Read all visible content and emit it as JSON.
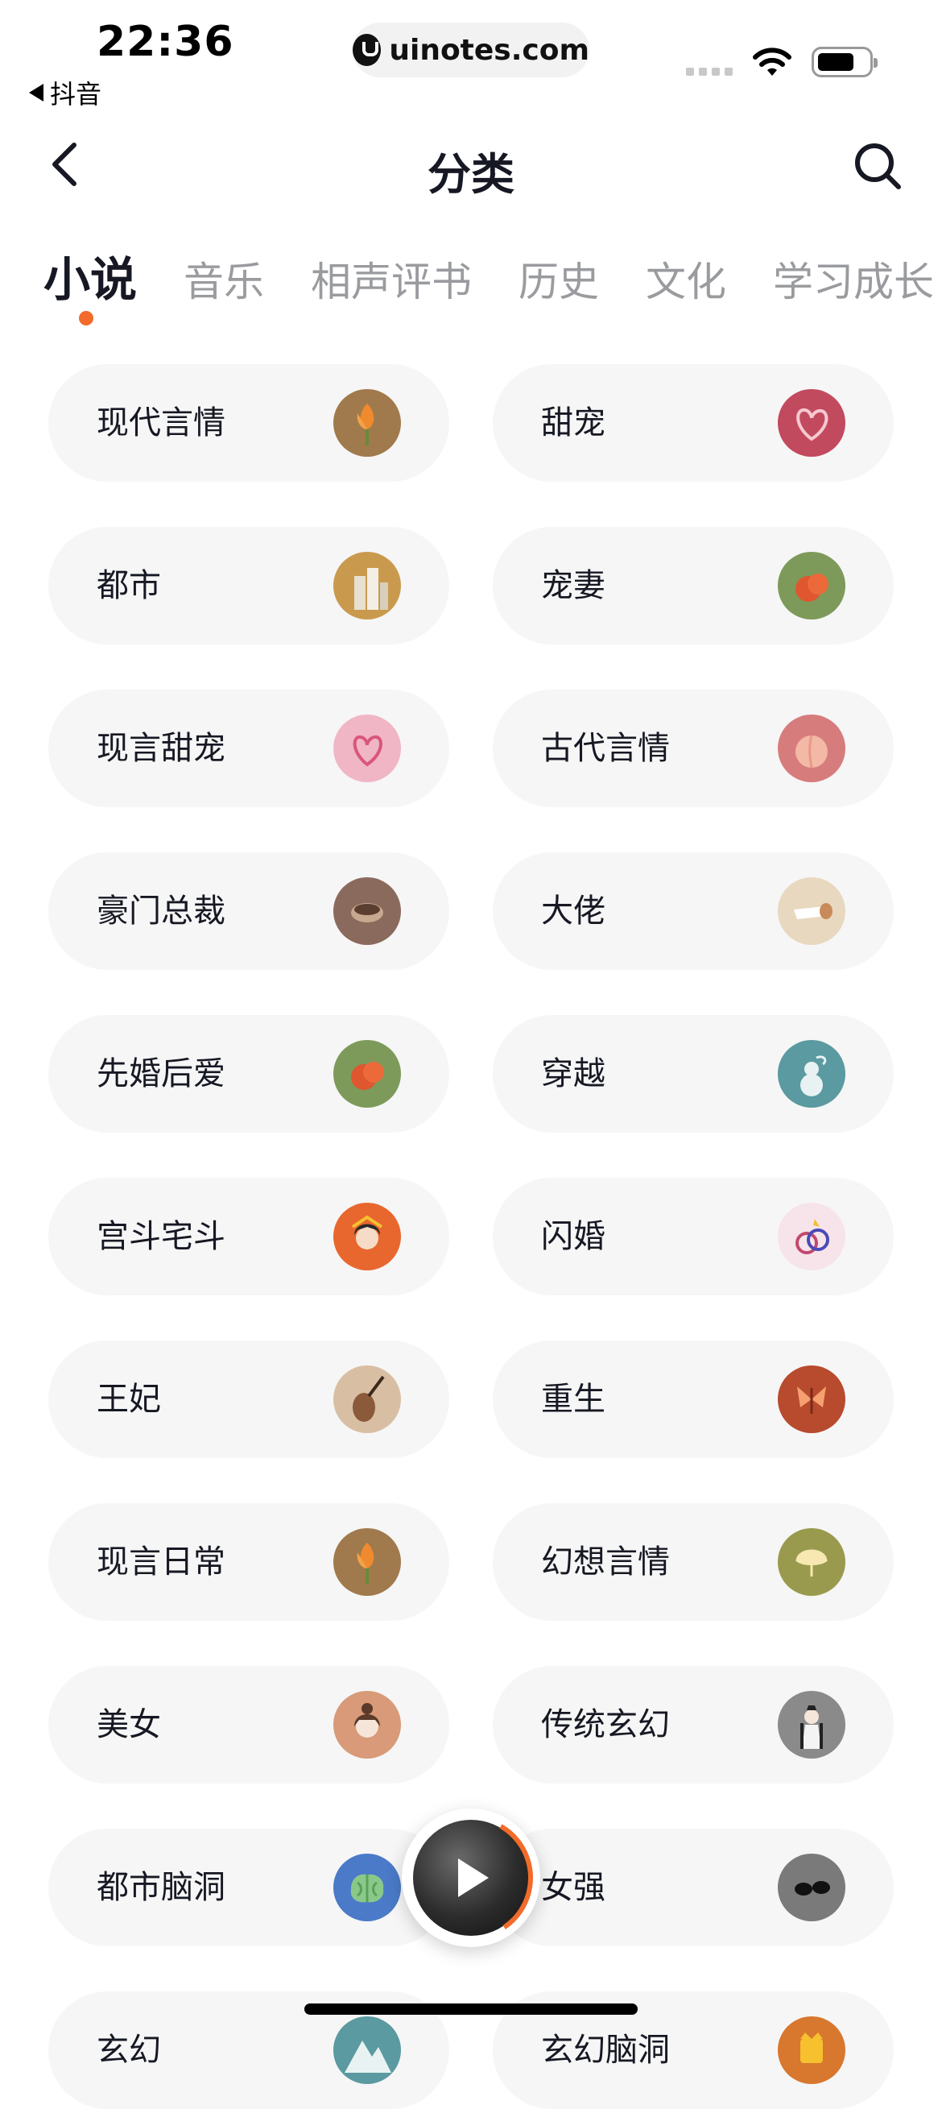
{
  "status_bar": {
    "time": "22:36",
    "back_app": "抖音",
    "url": "uinotes.com"
  },
  "navbar": {
    "title": "分类",
    "back_icon": "chevron-left-icon",
    "search_icon": "search-icon"
  },
  "tabs": [
    {
      "label": "小说",
      "active": true
    },
    {
      "label": "音乐",
      "active": false
    },
    {
      "label": "相声评书",
      "active": false
    },
    {
      "label": "历史",
      "active": false
    },
    {
      "label": "文化",
      "active": false
    },
    {
      "label": "学习成长",
      "active": false
    }
  ],
  "accent_color": "#f26b2a",
  "categories": [
    {
      "label": "现代言情",
      "icon": "lily-flower-icon",
      "color": "#a07a4c"
    },
    {
      "label": "甜宠",
      "icon": "heart-ribbon-icon",
      "color": "#c24a5e"
    },
    {
      "label": "都市",
      "icon": "city-buildings-icon",
      "color": "#c99a4e"
    },
    {
      "label": "宠妻",
      "icon": "red-flower-icon",
      "color": "#7d9a5a"
    },
    {
      "label": "现言甜宠",
      "icon": "pink-heart-icon",
      "color": "#f0b6c6"
    },
    {
      "label": "古代言情",
      "icon": "peach-icon",
      "color": "#d77c7c"
    },
    {
      "label": "豪门总裁",
      "icon": "cup-icon",
      "color": "#8b6a5e"
    },
    {
      "label": "大佬",
      "icon": "pipe-icon",
      "color": "#e8d8c0"
    },
    {
      "label": "先婚后爱",
      "icon": "red-flower-icon",
      "color": "#7d9a5a"
    },
    {
      "label": "穿越",
      "icon": "gourd-icon",
      "color": "#5a9aa0"
    },
    {
      "label": "宫斗宅斗",
      "icon": "empress-icon",
      "color": "#e8672e"
    },
    {
      "label": "闪婚",
      "icon": "rings-icon",
      "color": "#f6e4ea"
    },
    {
      "label": "王妃",
      "icon": "pipa-icon",
      "color": "#d8bfa4"
    },
    {
      "label": "重生",
      "icon": "butterfly-icon",
      "color": "#b84a2e"
    },
    {
      "label": "现言日常",
      "icon": "lily-flower-icon",
      "color": "#a07a4c"
    },
    {
      "label": "幻想言情",
      "icon": "ginkgo-icon",
      "color": "#9a9a4e"
    },
    {
      "label": "美女",
      "icon": "woman-icon",
      "color": "#d89a78"
    },
    {
      "label": "传统玄幻",
      "icon": "swordsman-icon",
      "color": "#8a8a8a"
    },
    {
      "label": "都市脑洞",
      "icon": "brain-icon",
      "color": "#4a7ac8"
    },
    {
      "label": "女强",
      "icon": "sunglasses-icon",
      "color": "#7a7a7a"
    },
    {
      "label": "玄幻",
      "icon": "mountain-icon",
      "color": "#5a9aa0"
    },
    {
      "label": "玄幻脑洞",
      "icon": "crown-icon",
      "color": "#d8772e"
    }
  ]
}
